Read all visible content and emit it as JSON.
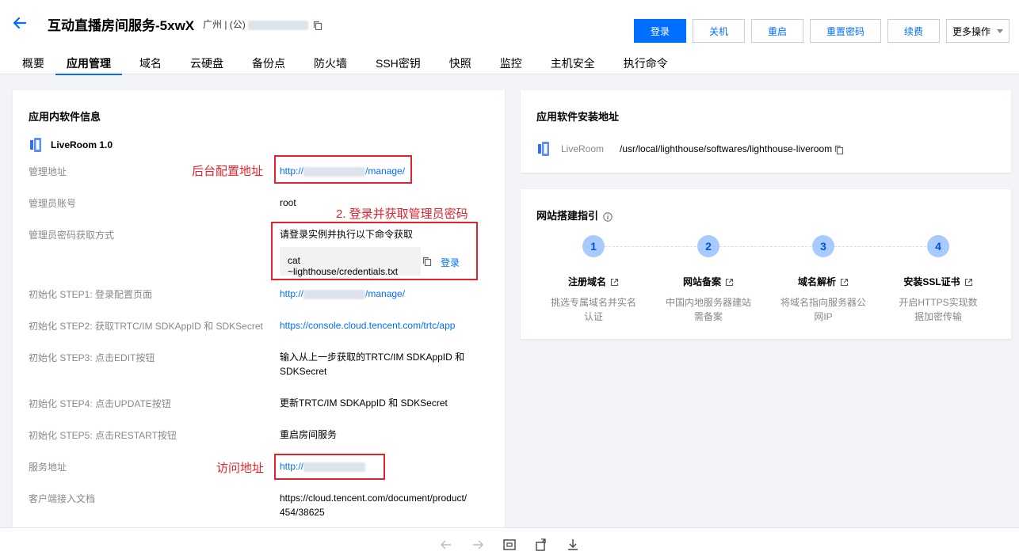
{
  "header": {
    "title": "互动直播房间服务-5xwX",
    "region": "广州 | (公)",
    "actions": {
      "login": "登录",
      "shutdown": "关机",
      "restart": "重启",
      "reset_password": "重置密码",
      "renew": "续费",
      "more": "更多操作"
    }
  },
  "tabs": [
    "概要",
    "应用管理",
    "域名",
    "云硬盘",
    "备份点",
    "防火墙",
    "SSH密钥",
    "快照",
    "监控",
    "主机安全",
    "执行命令"
  ],
  "software_info": {
    "title": "应用内软件信息",
    "app_name": "LiveRoom 1.0",
    "rows": {
      "admin_url_label": "管理地址",
      "admin_url_prefix": "http://",
      "admin_url_suffix": "/manage/",
      "admin_account_label": "管理员账号",
      "admin_account_value": "root",
      "pwd_label": "管理员密码获取方式",
      "pwd_value": "请登录实例并执行以下命令获取",
      "pwd_command": "cat ~lighthouse/credentials.txt",
      "pwd_login": "登录",
      "step1_label": "初始化 STEP1: 登录配置页面",
      "step1_prefix": "http://",
      "step1_suffix": "/manage/",
      "step2_label": "初始化 STEP2: 获取TRTC/IM SDKAppID 和 SDKSecret",
      "step2_value": "https://console.cloud.tencent.com/trtc/app",
      "step3_label": "初始化 STEP3: 点击EDIT按钮",
      "step3_value_line1": "输入从上一步获取的TRTC/IM SDKAppID 和",
      "step3_value_line2": "SDKSecret",
      "step4_label": "初始化 STEP4: 点击UPDATE按钮",
      "step4_value": "更新TRTC/IM SDKAppID 和 SDKSecret",
      "step5_label": "初始化 STEP5: 点击RESTART按钮",
      "step5_value": "重启房间服务",
      "service_label": "服务地址",
      "service_prefix": "http://",
      "client_doc_label": "客户端接入文档",
      "client_doc_line1": "https://cloud.tencent.com/document/product/",
      "client_doc_line2": "454/38625"
    },
    "annotations": {
      "backend": "后台配置地址",
      "login_pwd": "2. 登录并获取管理员密码",
      "access": "访问地址"
    }
  },
  "install_path": {
    "title": "应用软件安装地址",
    "app": "LiveRoom",
    "path": "/usr/local/lighthouse/softwares/lighthouse-liveroom"
  },
  "guide": {
    "title": "网站搭建指引",
    "steps": [
      {
        "num": "1",
        "title": "注册域名",
        "desc1": "挑选专属域名并实名",
        "desc2": "认证"
      },
      {
        "num": "2",
        "title": "网站备案",
        "desc1": "中国内地服务器建站",
        "desc2": "需备案"
      },
      {
        "num": "3",
        "title": "域名解析",
        "desc1": "将域名指向服务器公",
        "desc2": "网IP"
      },
      {
        "num": "4",
        "title": "安装SSL证书",
        "desc1": "开启HTTPS实现数",
        "desc2": "据加密传输"
      }
    ]
  },
  "colors": {
    "accent": "#006eff",
    "annotation": "#e3232b",
    "step_circle": "#a7cbff"
  }
}
